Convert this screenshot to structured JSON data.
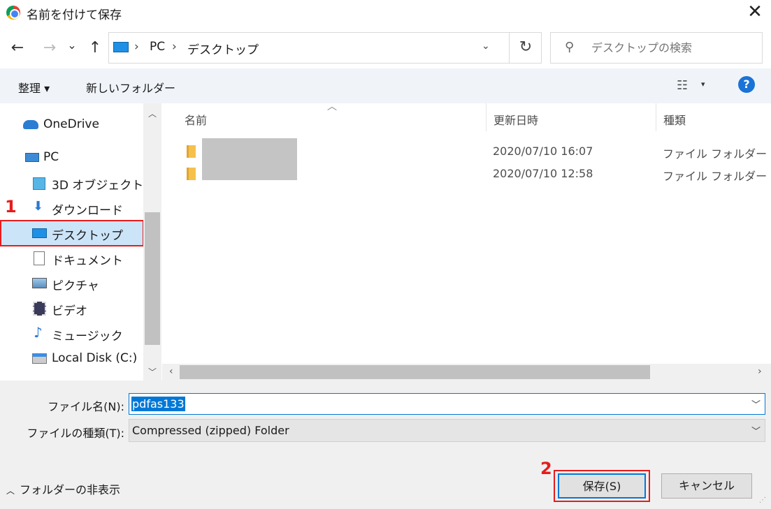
{
  "window": {
    "title": "名前を付けて保存",
    "close_glyph": "✕"
  },
  "nav": {
    "back_glyph": "←",
    "forward_glyph": "→",
    "recent_glyph": "⌄",
    "up_glyph": "↑",
    "breadcrumbs": [
      "PC",
      "デスクトップ"
    ],
    "separator": "›",
    "dropdown_glyph": "⌄",
    "refresh_glyph": "↻",
    "search_placeholder": "デスクトップの検索",
    "search_glyph": "⚲"
  },
  "toolbar": {
    "organize_label": "整理 ▾",
    "new_folder_label": "新しいフォルダー",
    "view_glyph": "☷",
    "view_dropdown_glyph": "▾",
    "help_glyph": "?"
  },
  "sidebar": {
    "items": [
      {
        "label": "OneDrive",
        "icon": "onedrive-icon"
      },
      {
        "label": "PC",
        "icon": "pc-icon"
      },
      {
        "label": "3D オブジェクト",
        "icon": "3d-objects-icon"
      },
      {
        "label": "ダウンロード",
        "icon": "downloads-icon"
      },
      {
        "label": "デスクトップ",
        "icon": "desktop-icon",
        "selected": true
      },
      {
        "label": "ドキュメント",
        "icon": "documents-icon"
      },
      {
        "label": "ピクチャ",
        "icon": "pictures-icon"
      },
      {
        "label": "ビデオ",
        "icon": "videos-icon"
      },
      {
        "label": "ミュージック",
        "icon": "music-icon"
      },
      {
        "label": "Local Disk (C:)",
        "icon": "local-disk-icon"
      }
    ],
    "step_number": "1"
  },
  "filelist": {
    "columns": {
      "name": "名前",
      "modified": "更新日時",
      "type": "種類"
    },
    "rows": [
      {
        "modified": "2020/07/10 16:07",
        "type": "ファイル フォルダー"
      },
      {
        "modified": "2020/07/10 12:58",
        "type": "ファイル フォルダー"
      }
    ]
  },
  "bottom": {
    "filename_label": "ファイル名(N):",
    "filename_value": "pdfas133",
    "filetype_label": "ファイルの種類(T):",
    "filetype_value": "Compressed (zipped) Folder",
    "hide_folders_label": "フォルダーの非表示",
    "save_label": "保存(S)",
    "cancel_label": "キャンセル",
    "step_number": "2"
  },
  "colors": {
    "accent": "#0078d7",
    "annotation": "#e61c1c",
    "selected_bg": "#cce4f7"
  }
}
